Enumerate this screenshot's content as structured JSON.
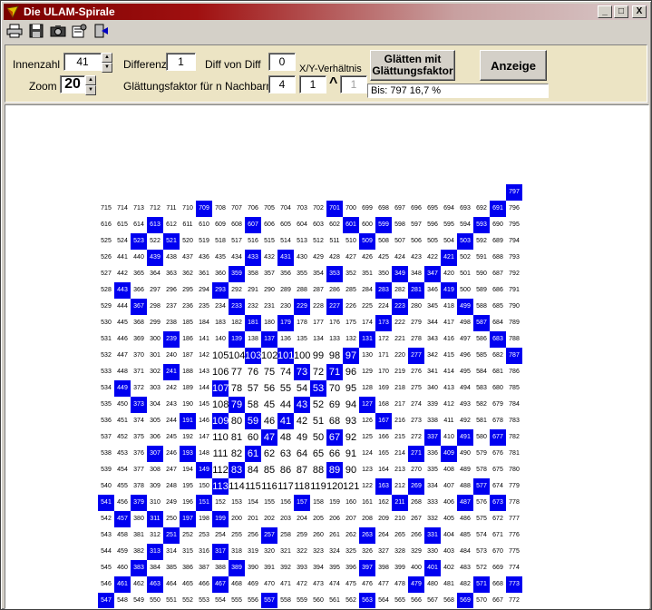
{
  "window": {
    "title": "Die ULAM-Spirale"
  },
  "titlebar_buttons": {
    "minimize": "_",
    "maximize": "□",
    "close": "X"
  },
  "toolbar": {
    "icons": [
      "print-icon",
      "save-icon",
      "camera-icon",
      "settings-icon",
      "exit-icon"
    ]
  },
  "controls": {
    "innenzahl_label": "Innenzahl",
    "innenzahl_value": "41",
    "zoom_label": "Zoom",
    "zoom_value": "20",
    "differenz_label": "Differenz",
    "differenz_value": "1",
    "diff_von_diff_label": "Diff von Diff",
    "diff_von_diff_value": "0",
    "xy_label": "X/Y-Verhältnis",
    "glaettung_label": "Glättungsfaktor für n Nachbarn",
    "glaettung_value": "4",
    "xy_value": "1",
    "caret": "^",
    "xy_disabled_value": "1",
    "glaetten_button": "Glätten mit Glättungsfaktor",
    "anzeige_button": "Anzeige",
    "status": "Bis: 797 16,7 %"
  },
  "colors": {
    "prime": "#0000f0",
    "highlight": "#ffff40",
    "marker": "#000000",
    "panel": "#ece4c4"
  },
  "spiral": {
    "center_number": 41,
    "max_number": 797
  }
}
